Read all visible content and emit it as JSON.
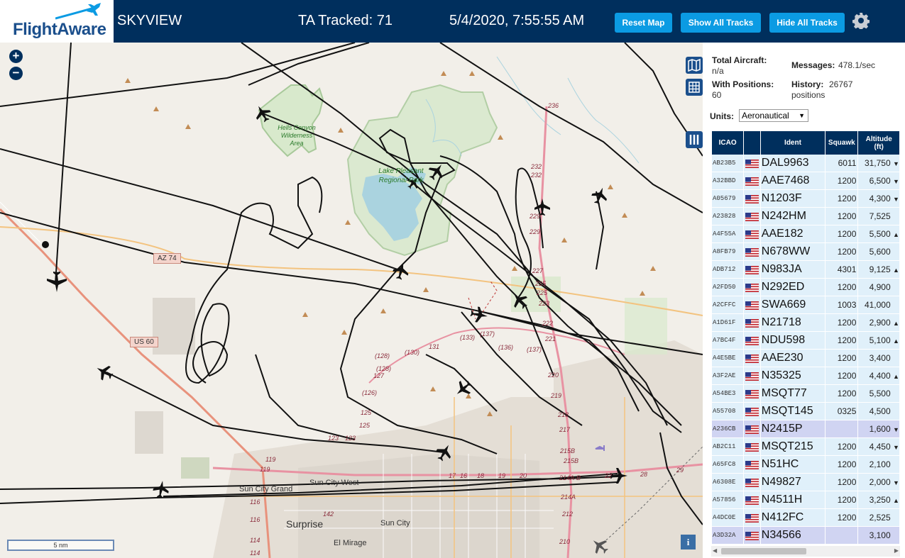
{
  "header": {
    "logo_text": "FlightAware",
    "app_title": "SKYVIEW",
    "ta_tracked": "TA Tracked: 71",
    "datetime": "5/4/2020, 7:55:55 AM",
    "buttons": {
      "reset": "Reset Map",
      "show_all": "Show All Tracks",
      "hide_all": "Hide All Tracks"
    },
    "settings_icon": "gear-icon",
    "colors": {
      "bar": "#002f5d",
      "button": "#0b9be3"
    }
  },
  "map": {
    "zoom_in": "+",
    "zoom_out": "−",
    "scale_label": "5 nm",
    "info_label": "i",
    "places": {
      "wilderness": "Hells Canyon Wilderness Area",
      "lake": "Lake Pleasant Regional Park",
      "sun_city_grand": "Sun City Grand",
      "sun_city_west": "Sun City West",
      "surprise": "Surprise",
      "sun_city": "Sun City",
      "el_mirage": "El Mirage"
    },
    "shields": {
      "az74": "AZ 74",
      "us60": "US 60"
    },
    "road_numbers": [
      "236",
      "232",
      "232",
      "229",
      "229",
      "227",
      "225",
      "225",
      "223",
      "222",
      "221",
      "220",
      "219",
      "218",
      "217",
      "215B",
      "215B",
      "214A-B",
      "214A",
      "212",
      "210",
      "(128)",
      "(128)",
      "(126)",
      "(130)",
      "(133)",
      "(137)",
      "(136)",
      "(137)",
      "127",
      "125",
      "125",
      "123",
      "123",
      "131",
      "119",
      "119",
      "116",
      "116",
      "114",
      "114",
      "142",
      "16",
      "17",
      "18",
      "19",
      "20",
      "22",
      "28",
      "29"
    ]
  },
  "panel": {
    "total_aircraft_label": "Total Aircraft:",
    "total_aircraft_value": "n/a",
    "with_positions_label": "With Positions:",
    "with_positions_value": "60",
    "messages_label": "Messages:",
    "messages_value": "478.1/sec",
    "history_label": "History:",
    "history_value": "26767 positions",
    "units_label": "Units:",
    "units_value": "Aeronautical",
    "columns": [
      "ICAO",
      "",
      "Ident",
      "Squawk",
      "Altitude (ft)"
    ],
    "rows": [
      {
        "icao": "AB23B5",
        "ident": "DAL9963",
        "squawk": "6011",
        "alt": "31,750",
        "trend": "▼"
      },
      {
        "icao": "A32BBD",
        "ident": "AAE7468",
        "squawk": "1200",
        "alt": "6,500",
        "trend": "▼"
      },
      {
        "icao": "A05679",
        "ident": "N1203F",
        "squawk": "1200",
        "alt": "4,300",
        "trend": "▼"
      },
      {
        "icao": "A23828",
        "ident": "N242HM",
        "squawk": "1200",
        "alt": "7,525",
        "trend": ""
      },
      {
        "icao": "A4F55A",
        "ident": "AAE182",
        "squawk": "1200",
        "alt": "5,500",
        "trend": "▲"
      },
      {
        "icao": "A8FB79",
        "ident": "N678WW",
        "squawk": "1200",
        "alt": "5,600",
        "trend": ""
      },
      {
        "icao": "ADB712",
        "ident": "N983JA",
        "squawk": "4301",
        "alt": "9,125",
        "trend": "▲"
      },
      {
        "icao": "A2FD50",
        "ident": "N292ED",
        "squawk": "1200",
        "alt": "4,900",
        "trend": ""
      },
      {
        "icao": "A2CFFC",
        "ident": "SWA669",
        "squawk": "1003",
        "alt": "41,000",
        "trend": ""
      },
      {
        "icao": "A1D61F",
        "ident": "N21718",
        "squawk": "1200",
        "alt": "2,900",
        "trend": "▲"
      },
      {
        "icao": "A7BC4F",
        "ident": "NDU598",
        "squawk": "1200",
        "alt": "5,100",
        "trend": "▲"
      },
      {
        "icao": "A4E5BE",
        "ident": "AAE230",
        "squawk": "1200",
        "alt": "3,400",
        "trend": ""
      },
      {
        "icao": "A3F2AE",
        "ident": "N35325",
        "squawk": "1200",
        "alt": "4,400",
        "trend": "▲"
      },
      {
        "icao": "A54BE3",
        "ident": "MSQT77",
        "squawk": "1200",
        "alt": "5,500",
        "trend": ""
      },
      {
        "icao": "A55708",
        "ident": "MSQT145",
        "squawk": "0325",
        "alt": "4,500",
        "trend": ""
      },
      {
        "icao": "A236CB",
        "ident": "N2415P",
        "squawk": "",
        "alt": "1,600",
        "trend": "▼",
        "selected": true
      },
      {
        "icao": "AB2C11",
        "ident": "MSQT215",
        "squawk": "1200",
        "alt": "4,450",
        "trend": "▼"
      },
      {
        "icao": "A65FC8",
        "ident": "N51HC",
        "squawk": "1200",
        "alt": "2,100",
        "trend": ""
      },
      {
        "icao": "A6308E",
        "ident": "N49827",
        "squawk": "1200",
        "alt": "2,000",
        "trend": "▼"
      },
      {
        "icao": "A57856",
        "ident": "N4511H",
        "squawk": "1200",
        "alt": "3,250",
        "trend": "▲"
      },
      {
        "icao": "A4DC0E",
        "ident": "N412FC",
        "squawk": "1200",
        "alt": "2,525",
        "trend": ""
      },
      {
        "icao": "A3D32A",
        "ident": "N34566",
        "squawk": "",
        "alt": "3,100",
        "trend": "",
        "selected": true
      }
    ]
  }
}
